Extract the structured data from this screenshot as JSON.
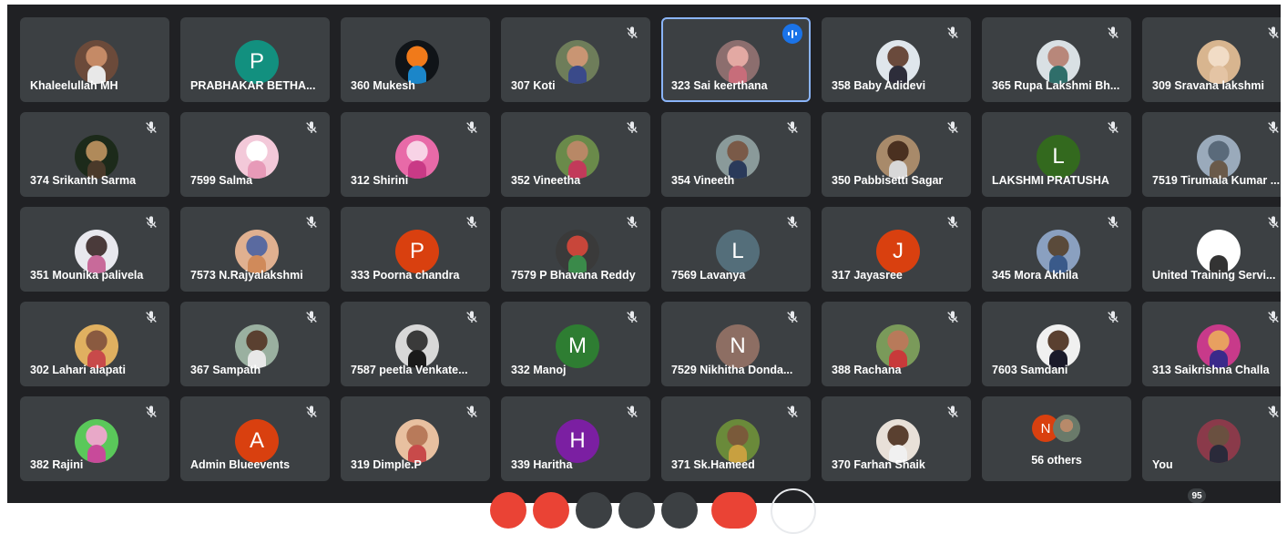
{
  "participants": [
    {
      "name": "Khaleelullah MH",
      "avatar": "photo",
      "c1": "#6b4a3a",
      "c2": "#c58a66",
      "c3": "#e8e8e8",
      "muted": false
    },
    {
      "name": "PRABHAKAR BETHA...",
      "avatar": "letter",
      "letter": "P",
      "color": "#12907f",
      "muted": false
    },
    {
      "name": "360 Mukesh",
      "avatar": "photo",
      "c1": "#101418",
      "c2": "#f07a1a",
      "c3": "#1b86c9",
      "muted": false
    },
    {
      "name": "307 Koti",
      "avatar": "photo",
      "c1": "#6e7d5a",
      "c2": "#c99573",
      "c3": "#3a4a8a",
      "muted": true
    },
    {
      "name": "323 Sai keerthana",
      "avatar": "photo",
      "c1": "#8c6e6e",
      "c2": "#e3a9a3",
      "c3": "#c76d7a",
      "muted": false,
      "speaking": true
    },
    {
      "name": "358 Baby Adidevi",
      "avatar": "photo",
      "c1": "#dfe6ec",
      "c2": "#6a4a3c",
      "c3": "#2d2d3a",
      "muted": true
    },
    {
      "name": "365 Rupa Lakshmi Bh...",
      "avatar": "photo",
      "c1": "#d9e0e4",
      "c2": "#b8877a",
      "c3": "#2f6e6a",
      "muted": true
    },
    {
      "name": "309 Sravana lakshmi",
      "avatar": "photo",
      "c1": "#d8b58f",
      "c2": "#f1dcc6",
      "c3": "#e4c4a4",
      "muted": true
    },
    {
      "name": "374 Srikanth Sarma",
      "avatar": "photo",
      "c1": "#1c2a1a",
      "c2": "#b08a5a",
      "c3": "#4a3a2a",
      "muted": true
    },
    {
      "name": "7599 Salma",
      "avatar": "photo",
      "c1": "#f3c9d9",
      "c2": "#ffffff",
      "c3": "#e79ab8",
      "muted": true
    },
    {
      "name": "312 Shirini",
      "avatar": "photo",
      "c1": "#e86aa8",
      "c2": "#f8d3e6",
      "c3": "#c93a86",
      "muted": true
    },
    {
      "name": "352 Vineetha",
      "avatar": "photo",
      "c1": "#6a8a4a",
      "c2": "#b88866",
      "c3": "#c23a5a",
      "muted": true
    },
    {
      "name": "354 Vineeth",
      "avatar": "photo",
      "c1": "#8a9a9a",
      "c2": "#7a5a48",
      "c3": "#2a3a5a",
      "muted": true
    },
    {
      "name": "350 Pabbisetti Sagar",
      "avatar": "photo",
      "c1": "#a88a6a",
      "c2": "#4a3020",
      "c3": "#d8d8d8",
      "muted": true
    },
    {
      "name": "LAKSHMI PRATUSHA",
      "avatar": "letter",
      "letter": "L",
      "color": "#33691e",
      "muted": true
    },
    {
      "name": "7519 Tirumala Kumar ...",
      "avatar": "photo",
      "c1": "#9aaabb",
      "c2": "#5a6a7a",
      "c3": "#6a5a4a",
      "muted": true
    },
    {
      "name": "351 Mounika palivela",
      "avatar": "photo",
      "c1": "#e8e8ee",
      "c2": "#4a3a3a",
      "c3": "#c86a9a",
      "muted": true
    },
    {
      "name": "7573 N.Rajyalakshmi",
      "avatar": "photo",
      "c1": "#e0b090",
      "c2": "#5a6aa0",
      "c3": "#d08a5a",
      "muted": true
    },
    {
      "name": "333 Poorna chandra",
      "avatar": "letter",
      "letter": "P",
      "color": "#d9400f",
      "muted": true
    },
    {
      "name": "7579 P Bhavana Reddy",
      "avatar": "photo",
      "c1": "#3a3a3a",
      "c2": "#c8463a",
      "c3": "#3a8a4a",
      "muted": true
    },
    {
      "name": "7569 Lavanya",
      "avatar": "letter",
      "letter": "L",
      "color": "#546e7a",
      "muted": true
    },
    {
      "name": "317 Jayasree",
      "avatar": "letter",
      "letter": "J",
      "color": "#d9400f",
      "muted": true
    },
    {
      "name": "345 Mora Akhila",
      "avatar": "photo",
      "c1": "#8aa0c0",
      "c2": "#5a4a3a",
      "c3": "#3a5a8a",
      "muted": true
    },
    {
      "name": "United Training Servi...",
      "avatar": "photo",
      "c1": "#ffffff",
      "c2": "#ffffff",
      "c3": "#333333",
      "muted": true
    },
    {
      "name": "302 Lahari alapati",
      "avatar": "photo",
      "c1": "#e0b060",
      "c2": "#8a5a40",
      "c3": "#c84a4a",
      "muted": true
    },
    {
      "name": "367 Sampath",
      "avatar": "photo",
      "c1": "#9ab0a0",
      "c2": "#5a4030",
      "c3": "#e8e8e8",
      "muted": true
    },
    {
      "name": "7587 peetla Venkate...",
      "avatar": "photo",
      "c1": "#d8d8d8",
      "c2": "#3a3a3a",
      "c3": "#1a1a1a",
      "muted": true
    },
    {
      "name": "332 Manoj",
      "avatar": "letter",
      "letter": "M",
      "color": "#2e7d32",
      "muted": true
    },
    {
      "name": "7529 Nikhitha Donda...",
      "avatar": "letter",
      "letter": "N",
      "color": "#8d6e63",
      "muted": true
    },
    {
      "name": "388 Rachana",
      "avatar": "photo",
      "c1": "#7a9a5a",
      "c2": "#b87a5a",
      "c3": "#c83a3a",
      "muted": true
    },
    {
      "name": "7603 Samdani",
      "avatar": "photo",
      "c1": "#f0f0f0",
      "c2": "#5a4030",
      "c3": "#1a1a2a",
      "muted": true
    },
    {
      "name": "313 Saikrishna Challa",
      "avatar": "photo",
      "c1": "#c83a8a",
      "c2": "#e8a060",
      "c3": "#3a2a8a",
      "muted": true
    },
    {
      "name": "382 Rajini",
      "avatar": "photo",
      "c1": "#5ac85a",
      "c2": "#e8a8c8",
      "c3": "#c84a9a",
      "muted": true
    },
    {
      "name": "Admin Blueevents",
      "avatar": "letter",
      "letter": "A",
      "color": "#d9400f",
      "muted": true
    },
    {
      "name": "319 Dimple.P",
      "avatar": "photo",
      "c1": "#e8c0a0",
      "c2": "#b87a5a",
      "c3": "#c84a4a",
      "muted": true
    },
    {
      "name": "339 Haritha",
      "avatar": "letter",
      "letter": "H",
      "color": "#7b1fa2",
      "muted": true
    },
    {
      "name": "371 Sk.Hameed",
      "avatar": "photo",
      "c1": "#6a8a3a",
      "c2": "#7a5a3a",
      "c3": "#c8a040",
      "muted": true
    },
    {
      "name": "370 Farhan Shaik",
      "avatar": "photo",
      "c1": "#e8e0d8",
      "c2": "#5a4030",
      "c3": "#f0f0f0",
      "muted": true
    },
    {
      "name": "56 others",
      "avatar": "others",
      "letter": "N",
      "color": "#d9400f",
      "muted": false
    },
    {
      "name": "You",
      "avatar": "photo",
      "c1": "#8a3a4a",
      "c2": "#6a5040",
      "c3": "#2a2a3a",
      "muted": true
    }
  ],
  "participant_count": "95",
  "colors": {
    "stage": "#202124",
    "tile": "#3c4043",
    "speaking": "#8ab4f8",
    "end_call": "#ea4335"
  }
}
